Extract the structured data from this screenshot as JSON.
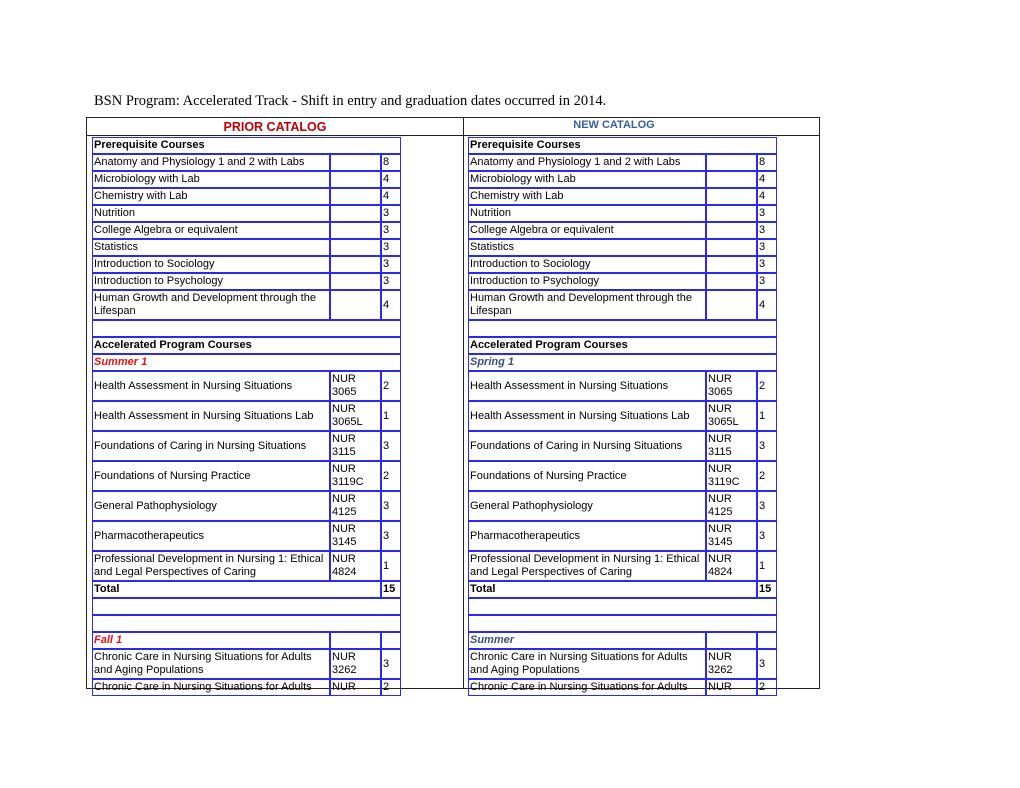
{
  "document": {
    "title": "BSN Program: Accelerated Track - Shift in entry and graduation dates occurred in 2014."
  },
  "colors": {
    "prior_catalog_heading": "#c00000",
    "new_catalog_heading": "#355ea0",
    "prior_term_label": "#ee1111",
    "new_term_label": "#3a4f7a",
    "cell_border": "#2a2aee"
  },
  "catalogs": [
    {
      "heading": "PRIOR CATALOG",
      "prereq_heading": "Prerequisite Courses",
      "prerequisites": [
        {
          "name": "Anatomy and Physiology 1 and 2 with Labs",
          "code": "",
          "credits": "8"
        },
        {
          "name": "Microbiology with Lab",
          "code": "",
          "credits": "4"
        },
        {
          "name": "Chemistry with Lab",
          "code": "",
          "credits": "4"
        },
        {
          "name": "Nutrition",
          "code": "",
          "credits": "3"
        },
        {
          "name": "College Algebra or equivalent",
          "code": "",
          "credits": "3"
        },
        {
          "name": "Statistics",
          "code": "",
          "credits": "3"
        },
        {
          "name": "Introduction to Sociology",
          "code": "",
          "credits": "3"
        },
        {
          "name": "Introduction to Psychology",
          "code": "",
          "credits": "3"
        },
        {
          "name": "Human Growth and Development through the Lifespan",
          "code": "",
          "credits": "4"
        }
      ],
      "program_heading": "Accelerated Program Courses",
      "term1": {
        "label": "Summer 1",
        "courses": [
          {
            "name": "Health Assessment in Nursing Situations",
            "code_prefix": "NUR",
            "code_number": "3065",
            "credits": "2"
          },
          {
            "name": "Health Assessment in Nursing Situations Lab",
            "code_prefix": "NUR",
            "code_number": "3065L",
            "credits": "1"
          },
          {
            "name": "Foundations of Caring in Nursing Situations",
            "code_prefix": "NUR",
            "code_number": "3115",
            "credits": "3"
          },
          {
            "name": "Foundations of Nursing Practice",
            "code_prefix": "NUR",
            "code_number": "3119C",
            "credits": "2"
          },
          {
            "name": "General Pathophysiology",
            "code_prefix": "NUR",
            "code_number": "4125",
            "credits": "3"
          },
          {
            "name": "Pharmacotherapeutics",
            "code_prefix": "NUR",
            "code_number": "3145",
            "credits": "3"
          },
          {
            "name": "Professional Development in Nursing 1: Ethical and Legal Perspectives of Caring",
            "code_prefix": "NUR",
            "code_number": "4824",
            "credits": "1"
          }
        ],
        "total_label": "Total",
        "total_credits": "15"
      },
      "term2": {
        "label": "Fall 1",
        "courses": [
          {
            "name": "Chronic Care in Nursing Situations for Adults and Aging Populations",
            "code_prefix": "NUR",
            "code_number": "3262",
            "credits": "3"
          },
          {
            "name": "Chronic Care in Nursing Situations for Adults",
            "code_prefix": "NUR",
            "code_number": "",
            "credits": "2"
          }
        ]
      }
    },
    {
      "heading": "NEW CATALOG",
      "prereq_heading": "Prerequisite Courses",
      "prerequisites": [
        {
          "name": "Anatomy and Physiology 1 and 2 with Labs",
          "code": "",
          "credits": "8"
        },
        {
          "name": "Microbiology with Lab",
          "code": "",
          "credits": "4"
        },
        {
          "name": "Chemistry with Lab",
          "code": "",
          "credits": "4"
        },
        {
          "name": "Nutrition",
          "code": "",
          "credits": "3"
        },
        {
          "name": "College Algebra or equivalent",
          "code": "",
          "credits": "3"
        },
        {
          "name": "Statistics",
          "code": "",
          "credits": "3"
        },
        {
          "name": "Introduction to Sociology",
          "code": "",
          "credits": "3"
        },
        {
          "name": "Introduction to Psychology",
          "code": "",
          "credits": "3"
        },
        {
          "name": "Human Growth and Development through the Lifespan",
          "code": "",
          "credits": "4"
        }
      ],
      "program_heading": "Accelerated Program Courses",
      "term1": {
        "label": "Spring 1",
        "courses": [
          {
            "name": "Health Assessment in Nursing Situations",
            "code_prefix": "NUR",
            "code_number": "3065",
            "credits": "2"
          },
          {
            "name": "Health Assessment in Nursing Situations Lab",
            "code_prefix": "NUR",
            "code_number": "3065L",
            "credits": "1"
          },
          {
            "name": "Foundations of Caring in Nursing Situations",
            "code_prefix": "NUR",
            "code_number": "3115",
            "credits": "3"
          },
          {
            "name": "Foundations of Nursing Practice",
            "code_prefix": "NUR",
            "code_number": "3119C",
            "credits": "2"
          },
          {
            "name": "General Pathophysiology",
            "code_prefix": "NUR",
            "code_number": "4125",
            "credits": "3"
          },
          {
            "name": "Pharmacotherapeutics",
            "code_prefix": "NUR",
            "code_number": "3145",
            "credits": "3"
          },
          {
            "name": "Professional Development in Nursing 1: Ethical and Legal Perspectives of Caring",
            "code_prefix": "NUR",
            "code_number": "4824",
            "credits": "1"
          }
        ],
        "total_label": "Total",
        "total_credits": "15"
      },
      "term2": {
        "label": "Summer",
        "courses": [
          {
            "name": "Chronic Care in Nursing Situations for Adults and Aging Populations",
            "code_prefix": "NUR",
            "code_number": "3262",
            "credits": "3"
          },
          {
            "name": "Chronic Care in Nursing Situations for Adults",
            "code_prefix": "NUR",
            "code_number": "",
            "credits": "2"
          }
        ]
      }
    }
  ]
}
